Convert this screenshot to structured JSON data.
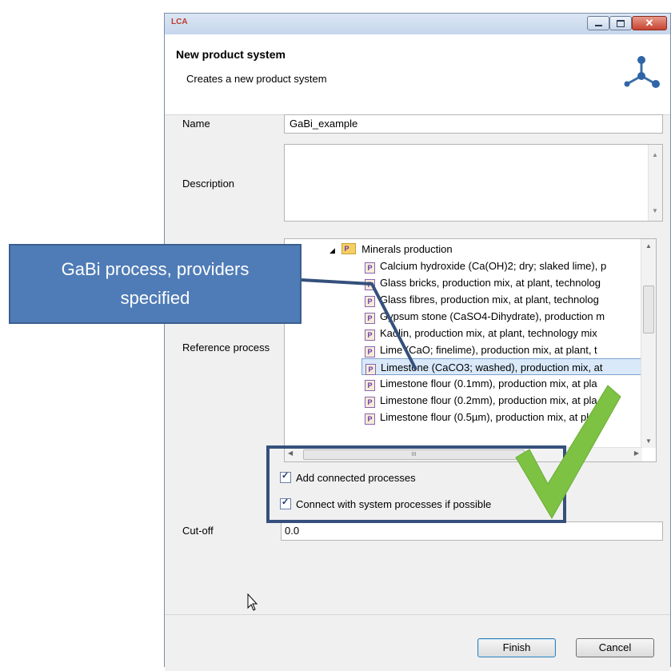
{
  "window": {
    "app_icon_text": "LCA",
    "controls": [
      "minimize",
      "maximize",
      "close"
    ]
  },
  "header": {
    "title": "New product system",
    "subtitle": "Creates a new product system",
    "icon": "product-system-icon"
  },
  "form": {
    "name_label": "Name",
    "name_value": "GaBi_example",
    "description_label": "Description",
    "description_value": "",
    "reference_label": "Reference process",
    "cutoff_label": "Cut-off",
    "cutoff_value": "0.0"
  },
  "tree": {
    "folder": "Minerals production",
    "folder_icon_letter": "P",
    "items": [
      "Calcium hydroxide (Ca(OH)2; dry; slaked lime), p",
      "Glass bricks, production mix, at plant, technolog",
      "Glass fibres, production mix, at plant, technolog",
      "Gypsum stone (CaSO4-Dihydrate), production m",
      "Kaolin, production mix, at plant, technology mix",
      "Lime (CaO; finelime), production mix, at plant, t",
      "Limestone (CaCO3; washed), production mix, at",
      "Limestone flour (0.1mm), production mix, at pla",
      "Limestone flour (0.2mm), production mix, at pla",
      "Limestone flour (0.5µm), production mix, at plar"
    ],
    "item_icon_letter": "P",
    "selected_index": 6,
    "hscroll_thumb_text": "III"
  },
  "options": {
    "add_connected": "Add connected processes",
    "connect_system": "Connect with system processes if possible",
    "add_connected_checked": true,
    "connect_system_checked": true
  },
  "buttons": {
    "finish": "Finish",
    "cancel": "Cancel"
  },
  "callout": {
    "text": "GaBi process, providers specified"
  },
  "colors": {
    "callout_fill": "#4f7cb7",
    "highlight_border": "#35507c",
    "checkmark": "#7dc242",
    "selection": "#d9e9fa"
  }
}
